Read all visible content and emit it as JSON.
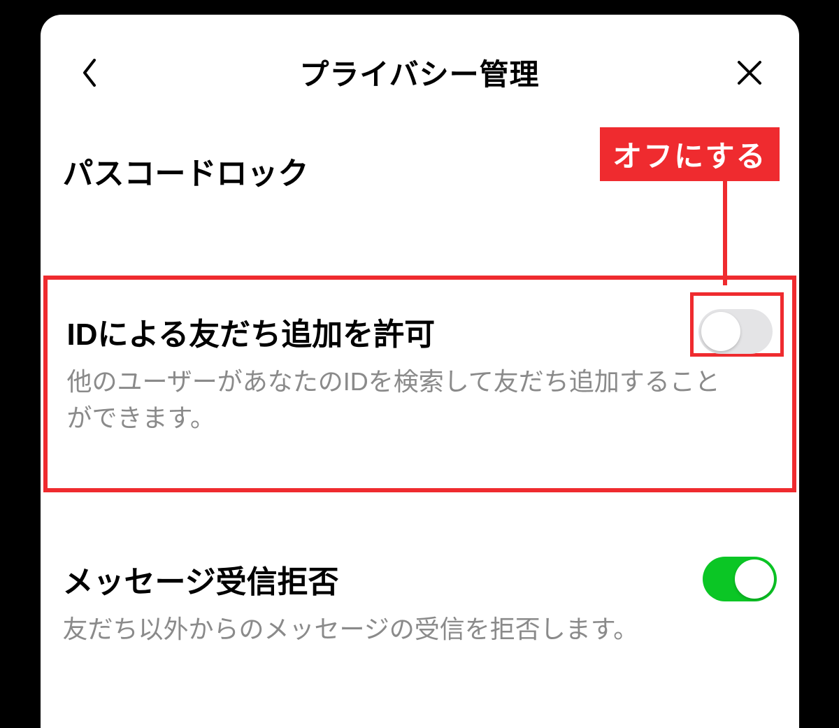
{
  "header": {
    "title": "プライバシー管理"
  },
  "settings": {
    "passcode": {
      "label": "パスコードロック"
    },
    "idFriendAdd": {
      "label": "IDによる友だち追加を許可",
      "description": "他のユーザーがあなたのIDを検索して友だち追加することができます。"
    },
    "messageReject": {
      "label": "メッセージ受信拒否",
      "description": "友だち以外からのメッセージの受信を拒否します。"
    }
  },
  "annotation": {
    "badge": "オフにする"
  }
}
